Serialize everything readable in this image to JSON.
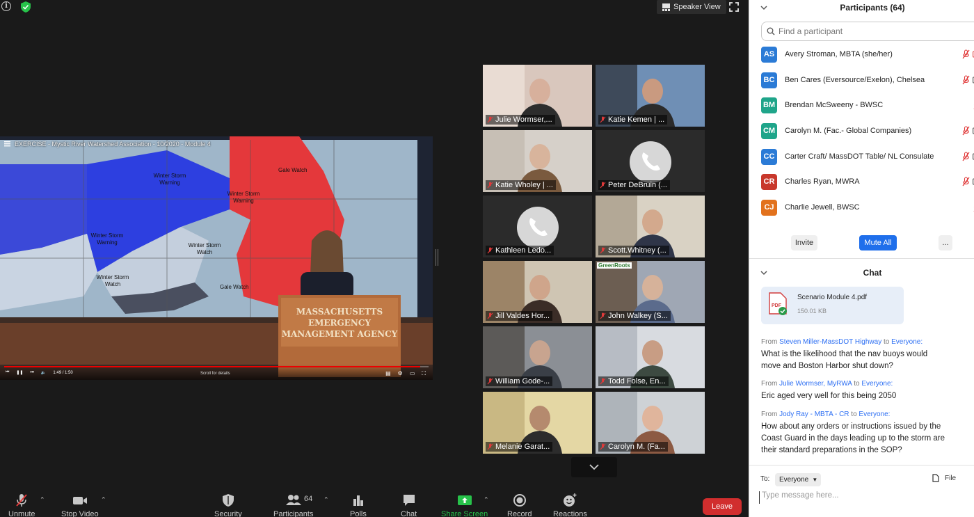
{
  "topbar": {
    "speaker_view_label": "Speaker View"
  },
  "share": {
    "video_title": "EXERCISE - Mystic River Watershed Association - 10/2020 - Module 4",
    "time": "1:49 / 1:50",
    "scroll_hint": "Scroll for details",
    "progress_fraction": 0.98,
    "podium_lines": [
      "MASSACHUSETTS",
      "EMERGENCY",
      "MANAGEMENT AGENCY"
    ],
    "map_labels": [
      "Winter Storm Warning",
      "Gale Watch",
      "Winter Storm Warning",
      "Winter Storm Warning",
      "Winter Storm Watch",
      "Winter Storm Watch",
      "Gale Watch"
    ]
  },
  "gallery": [
    {
      "name": "Julie Wormser,...",
      "type": "video",
      "active": false
    },
    {
      "name": "Katie Kemen | ...",
      "type": "video",
      "active": true
    },
    {
      "name": "Katie Wholey | ...",
      "type": "video",
      "active": false
    },
    {
      "name": "Peter DeBruin (...",
      "type": "phone",
      "active": false
    },
    {
      "name": "Kathleen Ledo...",
      "type": "phone",
      "active": false
    },
    {
      "name": "Scott.Whitney (...",
      "type": "video",
      "active": false
    },
    {
      "name": "Jill Valdes Hor...",
      "type": "video",
      "active": false
    },
    {
      "name": "John Walkey (S...",
      "type": "video",
      "active": false,
      "badge": "GreenRoots"
    },
    {
      "name": "William Gode-...",
      "type": "video",
      "active": false
    },
    {
      "name": "Todd Folse, En...",
      "type": "video",
      "active": false
    },
    {
      "name": "Melanie Garat...",
      "type": "video",
      "active": false
    },
    {
      "name": "Carolyn M. (Fa...",
      "type": "video",
      "active": false
    }
  ],
  "toolbar": {
    "unmute": "Unmute",
    "stop_video": "Stop Video",
    "security": "Security",
    "participants": "Participants",
    "participants_count": "64",
    "polls": "Polls",
    "chat": "Chat",
    "share_screen": "Share Screen",
    "record": "Record",
    "reactions": "Reactions",
    "leave": "Leave"
  },
  "participants_panel": {
    "title": "Participants (64)",
    "search_placeholder": "Find a participant",
    "list": [
      {
        "initials": "AS",
        "name": "Avery Stroman, MBTA (she/her)",
        "color": "#2b7bd6"
      },
      {
        "initials": "BC",
        "name": "Ben Cares (Eversource/Exelon), Chelsea",
        "color": "#2b7bd6"
      },
      {
        "initials": "BM",
        "name": "Brendan McSweeny - BWSC",
        "color": "#1fa58a"
      },
      {
        "initials": "CM",
        "name": "Carolyn M. (Fac.- Global Companies)",
        "color": "#1fa58a"
      },
      {
        "initials": "CC",
        "name": "Carter Craft/ MassDOT Table/ NL Consulate",
        "color": "#2b7bd6"
      },
      {
        "initials": "CR",
        "name": "Charles Ryan, MWRA",
        "color": "#c8382c"
      },
      {
        "initials": "CJ",
        "name": "Charlie Jewell, BWSC",
        "color": "#e2721d"
      }
    ],
    "invite": "Invite",
    "mute_all": "Mute All",
    "more": "..."
  },
  "chat": {
    "title": "Chat",
    "file": {
      "name": "Scenario Module 4.pdf",
      "size": "150.01 KB"
    },
    "messages": [
      {
        "from_label": "From",
        "from": "Steven Miller-MassDOT Highway",
        "to_label": "to",
        "to": "Everyone:",
        "text": "What is the likelihood that the nav buoys would move and Boston Harbor shut down?"
      },
      {
        "from_label": "From",
        "from": "Julie Wormser, MyRWA",
        "to_label": "to",
        "to": "Everyone:",
        "text": "Eric aged very well for this being 2050"
      },
      {
        "from_label": "From",
        "from": "Jody Ray - MBTA - CR",
        "to_label": "to",
        "to": "Everyone:",
        "text": "How about any orders or instructions issued by the Coast Guard in the days leading up to the storm  are their standard preparations in the SOP?"
      }
    ],
    "to_label": "To:",
    "to_value": "Everyone",
    "file_button": "File",
    "compose_placeholder": "Type message here..."
  }
}
